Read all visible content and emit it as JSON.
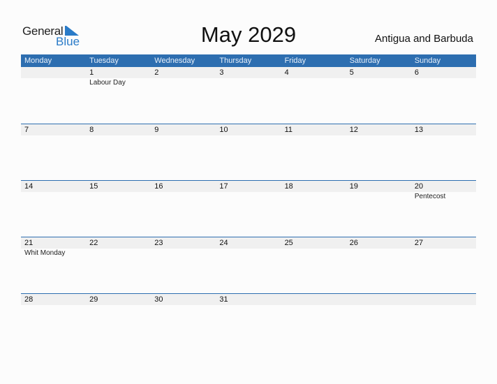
{
  "logo": {
    "general": "General",
    "blue": "Blue"
  },
  "title": "May 2029",
  "country": "Antigua and Barbuda",
  "weekdays": [
    "Monday",
    "Tuesday",
    "Wednesday",
    "Thursday",
    "Friday",
    "Saturday",
    "Sunday"
  ],
  "weeks": [
    {
      "days": [
        "",
        "1",
        "2",
        "3",
        "4",
        "5",
        "6"
      ],
      "events": [
        "",
        "Labour Day",
        "",
        "",
        "",
        "",
        ""
      ]
    },
    {
      "days": [
        "7",
        "8",
        "9",
        "10",
        "11",
        "12",
        "13"
      ],
      "events": [
        "",
        "",
        "",
        "",
        "",
        "",
        ""
      ]
    },
    {
      "days": [
        "14",
        "15",
        "16",
        "17",
        "18",
        "19",
        "20"
      ],
      "events": [
        "",
        "",
        "",
        "",
        "",
        "",
        "Pentecost"
      ]
    },
    {
      "days": [
        "21",
        "22",
        "23",
        "24",
        "25",
        "26",
        "27"
      ],
      "events": [
        "Whit Monday",
        "",
        "",
        "",
        "",
        "",
        ""
      ]
    },
    {
      "days": [
        "28",
        "29",
        "30",
        "31",
        "",
        "",
        ""
      ],
      "events": [
        "",
        "",
        "",
        "",
        "",
        "",
        ""
      ]
    }
  ]
}
